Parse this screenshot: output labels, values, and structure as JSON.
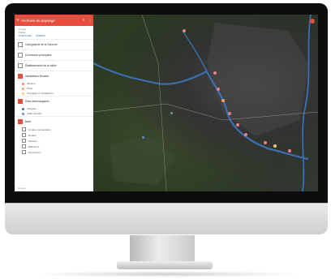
{
  "app": {
    "title": "Archives du paysage",
    "menu_icon": "menu-icon",
    "search_icon": "search-icon",
    "more_icon": "more-vert-icon"
  },
  "panel": {
    "meta_line1": "0 vues",
    "meta_line2": "Publié",
    "actions": [
      "PARTAGER",
      "APERÇU"
    ],
    "layers": [
      {
        "label": "Cartographie de la Garonne",
        "checked": false
      },
      {
        "label": "Communes principales",
        "checked": false
      },
      {
        "label": "Établissements de la vallée",
        "checked": false
      },
      {
        "label": "Installations fluviales",
        "checked": true
      },
      {
        "label": "Sites archéologiques",
        "checked": true
      },
      {
        "label": "Base",
        "checked": true
      }
    ],
    "sublayers": {
      "installations": [
        "Moulins",
        "Ports",
        "Ouvrages et installations"
      ],
      "sites": [
        "Antiques",
        "Gallo-romains"
      ],
      "base": [
        "Limites communales",
        "Routes",
        "Fleuves",
        "Bâtiments",
        "Toponymes"
      ]
    },
    "footer": "Google"
  },
  "colors": {
    "accent": "#e74c3c",
    "map_marker": "#f08080",
    "river": "#3a6fb0"
  },
  "chart_data": null
}
